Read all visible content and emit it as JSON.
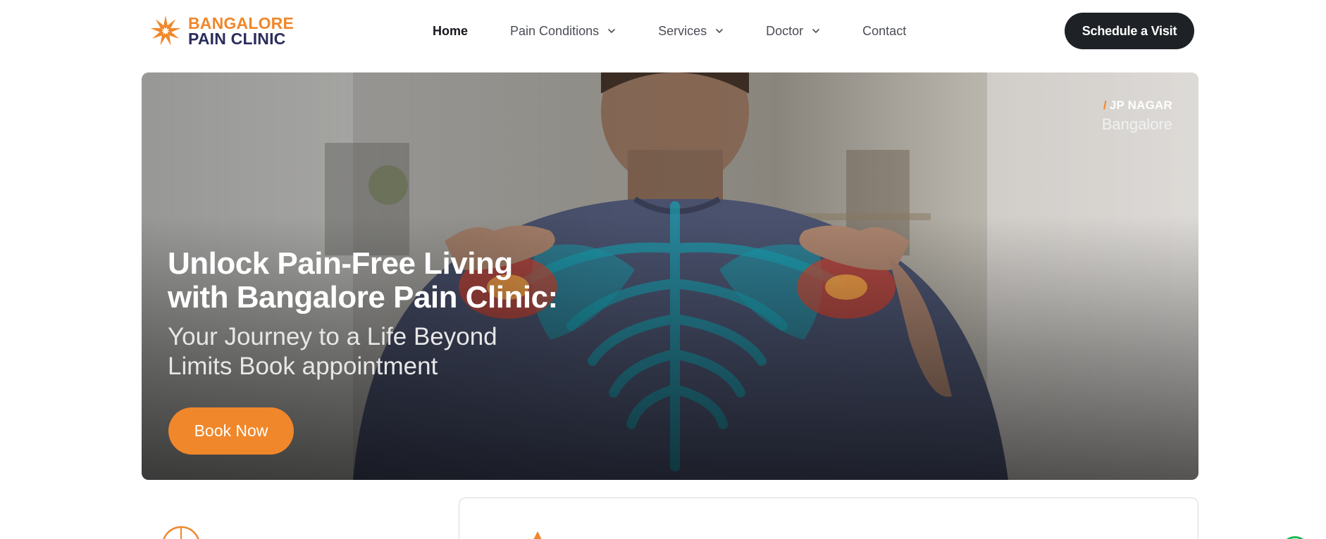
{
  "brand": {
    "name_line1": "BANGALORE",
    "name_line2": "PAIN CLINIC",
    "colors": {
      "orange": "#f0872a",
      "navy": "#2a2d5c"
    },
    "icon": "starburst-logo-icon"
  },
  "nav": {
    "items": [
      {
        "label": "Home",
        "active": true,
        "dropdown": false
      },
      {
        "label": "Pain Conditions",
        "active": false,
        "dropdown": true
      },
      {
        "label": "Services",
        "active": false,
        "dropdown": true
      },
      {
        "label": "Doctor",
        "active": false,
        "dropdown": true
      },
      {
        "label": "Contact",
        "active": false,
        "dropdown": false
      }
    ],
    "dropdown_icon": "chevron-down-icon"
  },
  "cta": {
    "label": "Schedule a Visit",
    "color": "#1e2126"
  },
  "hero": {
    "location_area": "JP NAGAR",
    "location_city": "Bangalore",
    "title_line1": "Unlock Pain-Free Living",
    "title_line2": "with Bangalore Pain Clinic:",
    "subtitle_line1": "Your Journey to a Life Beyond",
    "subtitle_line2": "Limits Book appointment",
    "button_label": "Book Now",
    "button_color": "#f0872a"
  },
  "below": {
    "left_icon": "globe-icon",
    "card_icon": "triangle-icon",
    "edge_badge_color": "#1db954"
  }
}
